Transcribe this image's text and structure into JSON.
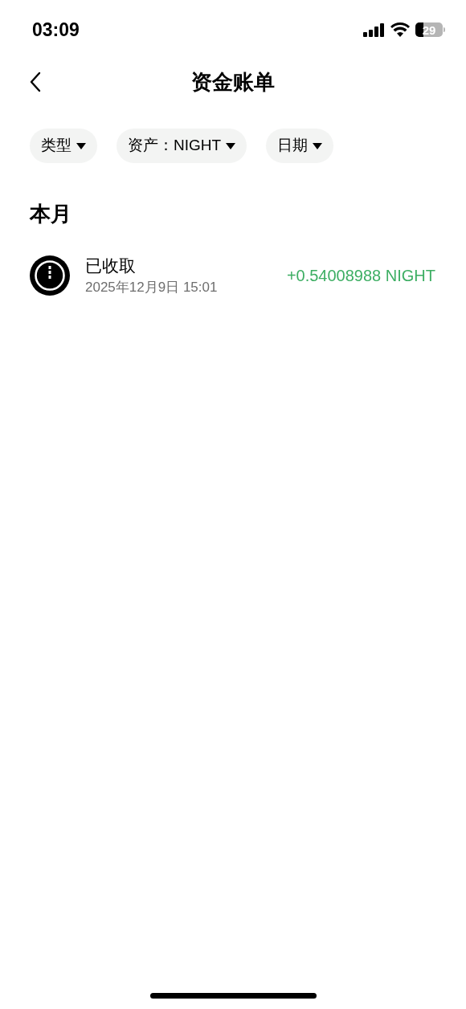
{
  "status_bar": {
    "time": "03:09",
    "battery": "29"
  },
  "header": {
    "title": "资金账单"
  },
  "filters": [
    {
      "label": "类型"
    },
    {
      "label": "资产：NIGHT"
    },
    {
      "label": "日期"
    }
  ],
  "section": {
    "title": "本月"
  },
  "transactions": [
    {
      "title": "已收取",
      "date": "2025年12月9日 15:01",
      "amount": "+0.54008988 NIGHT",
      "color": "#3dae63"
    }
  ]
}
